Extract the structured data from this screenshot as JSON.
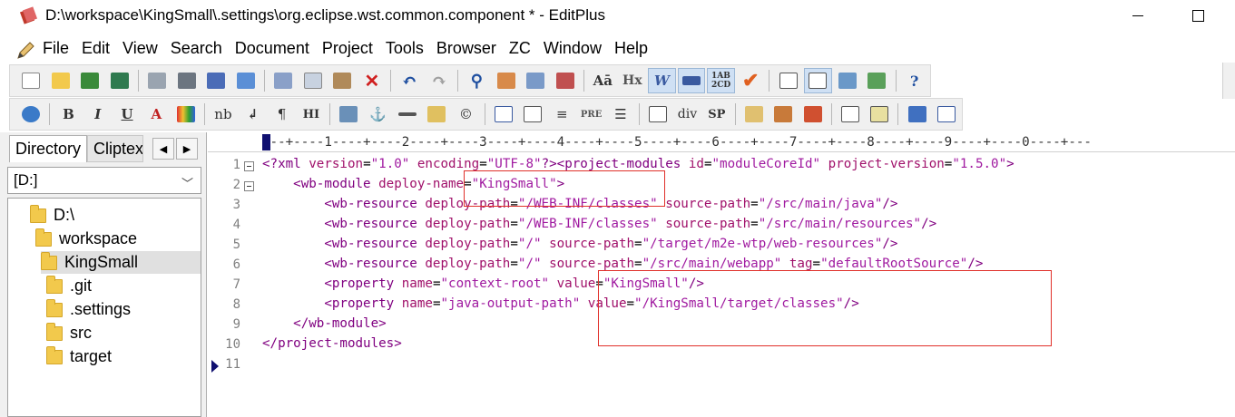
{
  "window": {
    "title": "D:\\workspace\\KingSmall\\.settings\\org.eclipse.wst.common.component * - EditPlus"
  },
  "menu": [
    "File",
    "Edit",
    "View",
    "Search",
    "Document",
    "Project",
    "Tools",
    "Browser",
    "ZC",
    "Window",
    "Help"
  ],
  "toolbar2_text": {
    "nb": "nb",
    "hi": "HI",
    "pre": "PRE",
    "div": "div",
    "sp": "SP",
    "hx": "Hx"
  },
  "left_panel": {
    "tabs": [
      "Directory",
      "Cliptex"
    ],
    "drive": "[D:]",
    "tree": [
      {
        "label": "D:\\",
        "level": 0,
        "selected": false
      },
      {
        "label": "workspace",
        "level": 1,
        "selected": false
      },
      {
        "label": "KingSmall",
        "level": 2,
        "selected": true
      },
      {
        "label": ".git",
        "level": 3,
        "selected": false
      },
      {
        "label": ".settings",
        "level": 3,
        "selected": false
      },
      {
        "label": "src",
        "level": 3,
        "selected": false
      },
      {
        "label": "target",
        "level": 3,
        "selected": false
      }
    ]
  },
  "editor": {
    "ruler": "---+----1----+----2----+----3----+----4----+----5----+----6----+----7----+----8----+----9----+----0----+---",
    "line_numbers": [
      "1",
      "2",
      "3",
      "4",
      "5",
      "6",
      "7",
      "8",
      "9",
      "10",
      "11"
    ],
    "lines": [
      "<?xml version=\"1.0\" encoding=\"UTF-8\"?><project-modules id=\"moduleCoreId\" project-version=\"1.5.0\">",
      "    <wb-module deploy-name=\"KingSmall\">",
      "        <wb-resource deploy-path=\"/WEB-INF/classes\" source-path=\"/src/main/java\"/>",
      "        <wb-resource deploy-path=\"/WEB-INF/classes\" source-path=\"/src/main/resources\"/>",
      "        <wb-resource deploy-path=\"/\" source-path=\"/target/m2e-wtp/web-resources\"/>",
      "        <wb-resource deploy-path=\"/\" source-path=\"/src/main/webapp\" tag=\"defaultRootSource\"/>",
      "        <property name=\"context-root\" value=\"KingSmall\"/>",
      "        <property name=\"java-output-path\" value=\"/KingSmall/target/classes\"/>",
      "    </wb-module>",
      "</project-modules>",
      ""
    ]
  },
  "colors": {
    "tag": "#800080",
    "attr": "#a0106a",
    "value": "#a01aa0",
    "highlight_box": "#e0302a"
  }
}
